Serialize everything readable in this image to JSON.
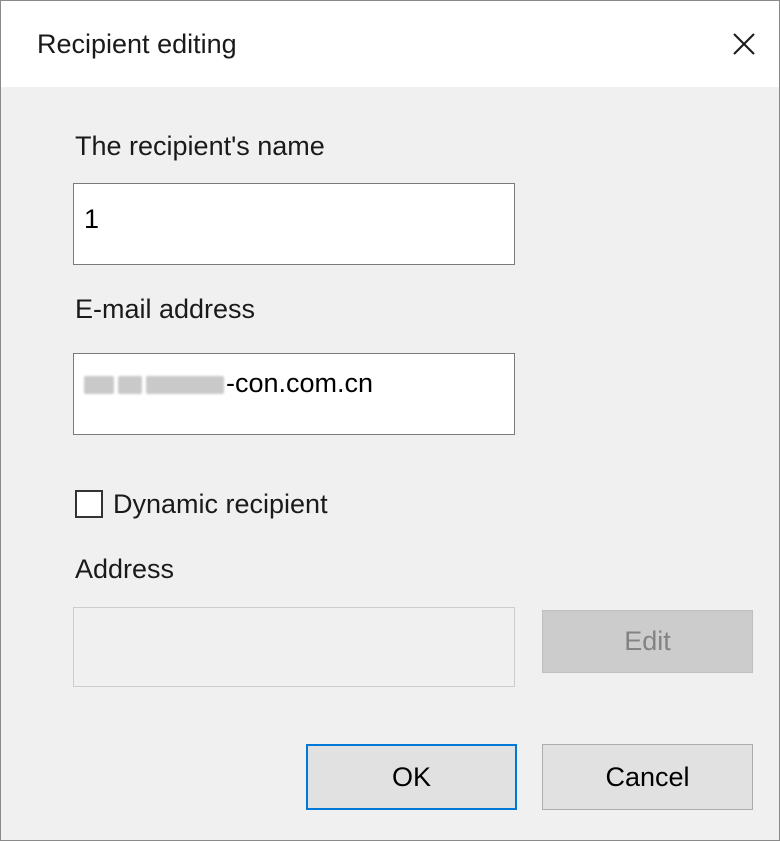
{
  "dialog": {
    "title": "Recipient editing",
    "close_icon": "close-icon"
  },
  "form": {
    "name_label": "The recipient's name",
    "name_value": "1",
    "email_label": "E-mail address",
    "email_value_visible": "-con.com.cn",
    "dynamic_checkbox_label": "Dynamic recipient",
    "dynamic_checked": false,
    "address_label": "Address",
    "address_value": "",
    "edit_button_label": "Edit"
  },
  "buttons": {
    "ok_label": "OK",
    "cancel_label": "Cancel"
  },
  "colors": {
    "accent": "#0078d7",
    "dialog_bg": "#f0f0f0",
    "titlebar_bg": "#ffffff",
    "disabled_button_bg": "#cccccc",
    "disabled_text": "#838383"
  }
}
